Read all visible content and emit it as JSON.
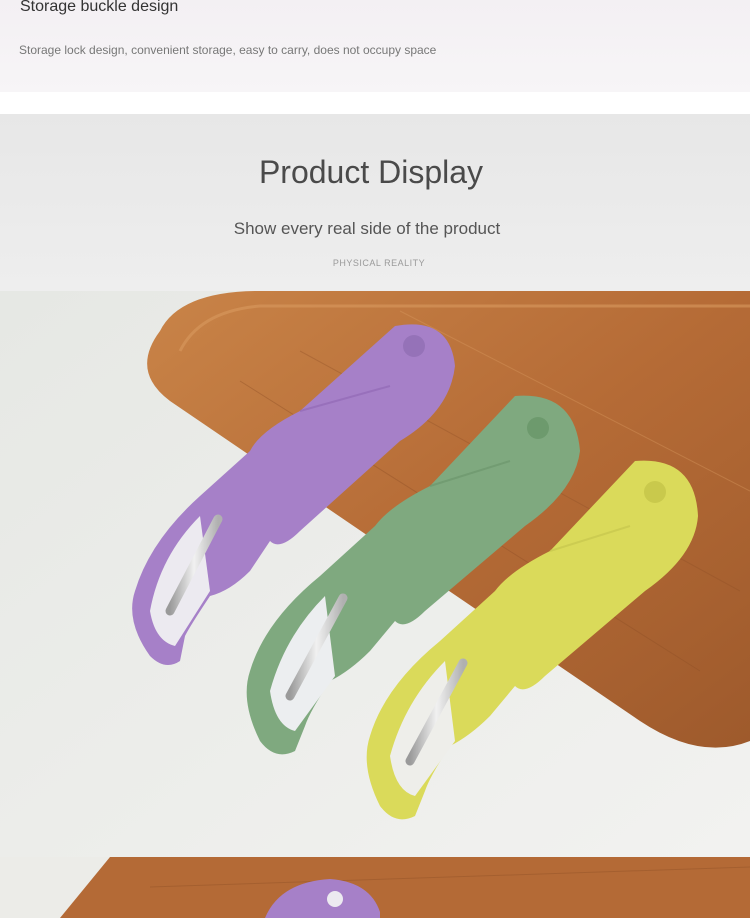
{
  "feature": {
    "title": "Storage buckle design",
    "description": "Storage lock design, convenient storage, easy to carry, does not occupy space"
  },
  "display": {
    "title": "Product Display",
    "subtitle": "Show every real side of the product",
    "tag": "PHYSICAL REALITY"
  },
  "colors": {
    "peeler_purple": "#a680c8",
    "peeler_green": "#7fa97f",
    "peeler_yellow": "#dada5a",
    "cutting_board": "#b8713d",
    "header_bg": "#e9e9e9"
  }
}
